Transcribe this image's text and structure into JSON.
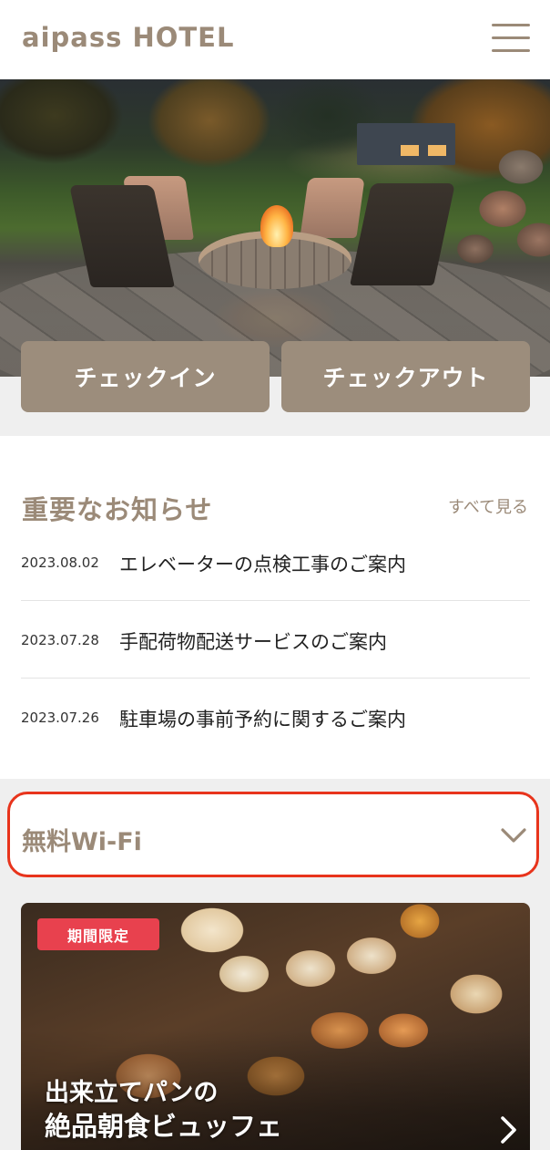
{
  "header": {
    "brand": "aipass HOTEL",
    "menu_icon": "hamburger-menu-icon"
  },
  "hero": {
    "image_subject": "firepit-patio-photo"
  },
  "actions": {
    "checkin_label": "チェックイン",
    "checkout_label": "チェックアウト"
  },
  "notices": {
    "title": "重要なお知らせ",
    "see_all_label": "すべて見る",
    "items": [
      {
        "date": "2023.08.02",
        "text": "エレベーターの点検工事のご案内"
      },
      {
        "date": "2023.07.28",
        "text": "手配荷物配送サービスのご案内"
      },
      {
        "date": "2023.07.26",
        "text": "駐車場の事前予約に関するご案内"
      }
    ]
  },
  "wifi": {
    "label": "無料Wi-Fi",
    "icon": "chevron-down-icon",
    "highlight_color": "#e8341c"
  },
  "promo": {
    "badge": "期間限定",
    "title_line1": "出来立てパンの",
    "title_line2": "絶品朝食ビュッフェ",
    "icon": "chevron-right-icon",
    "badge_color": "#e8414e"
  },
  "colors": {
    "accent": "#9b8a78",
    "button": "#9c8d7c",
    "background": "#efefef"
  }
}
